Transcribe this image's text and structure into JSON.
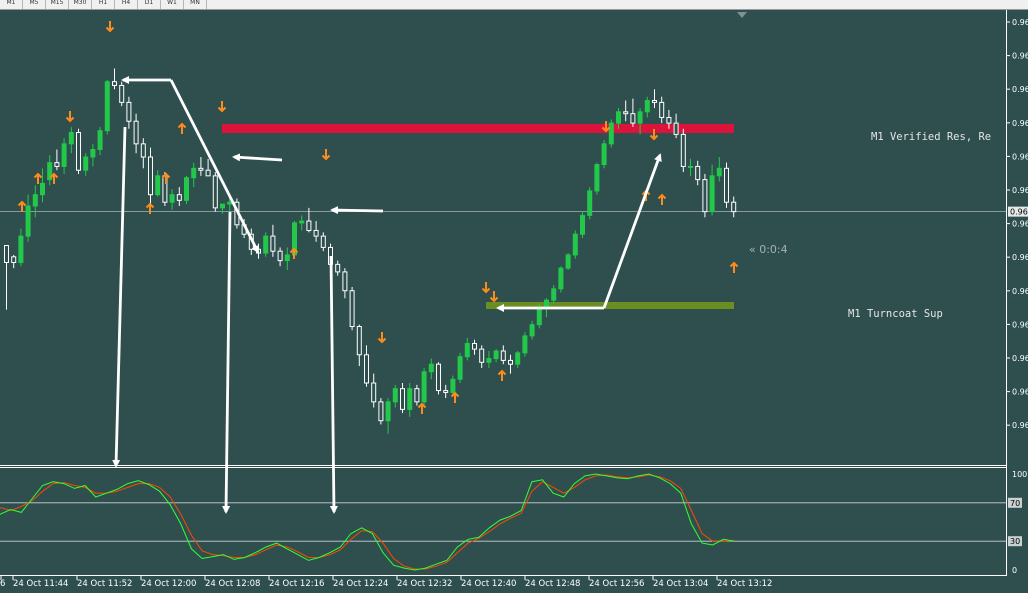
{
  "toolbar": {
    "timeframes": [
      "M1",
      "M5",
      "M15",
      "M30",
      "H1",
      "H4",
      "D1",
      "W1",
      "MN"
    ]
  },
  "chart_data": {
    "type": "candlestick",
    "price_axis_labels": [
      "0.96",
      "0.96",
      "0.96",
      "0.96",
      "0.96",
      "0.96",
      "0.96",
      "0.96",
      "0.96",
      "0.96",
      "0.96",
      "0.96",
      "0.96"
    ],
    "current_price_label": "0.96",
    "countdown": "« 0:0:4",
    "resistance_label": "M1 Verified Res, Re",
    "support_label": "M1 Turncoat Sup",
    "time_labels": [
      "6",
      "24 Oct 11:44",
      "24 Oct 11:52",
      "24 Oct 12:00",
      "24 Oct 12:08",
      "24 Oct 12:16",
      "24 Oct 12:24",
      "24 Oct 12:32",
      "24 Oct 12:40",
      "24 Oct 12:48",
      "24 Oct 12:56",
      "24 Oct 13:04",
      "24 Oct 13:12"
    ],
    "oscillator_levels": [
      100,
      70,
      30,
      0
    ],
    "oscillator_level_labels": [
      "100",
      "70",
      "30",
      "0"
    ],
    "candles": [
      [
        97.2,
        95.6,
        90.4,
        95.4
      ],
      [
        96.0,
        96.2,
        94.8,
        95.4
      ],
      [
        95.4,
        99.0,
        95.0,
        98.2
      ],
      [
        98.2,
        102.6,
        97.6,
        101.4
      ],
      [
        101.4,
        103.6,
        100.2,
        102.6
      ],
      [
        102.6,
        105.4,
        101.8,
        103.8
      ],
      [
        104.2,
        106.8,
        103.6,
        106.0
      ],
      [
        106.0,
        107.4,
        105.2,
        105.6
      ],
      [
        105.6,
        108.6,
        104.8,
        108.0
      ],
      [
        108.0,
        109.8,
        107.0,
        109.2
      ],
      [
        109.2,
        109.6,
        104.8,
        105.2
      ],
      [
        105.2,
        107.0,
        104.6,
        106.6
      ],
      [
        106.6,
        108.0,
        105.6,
        107.4
      ],
      [
        107.4,
        109.8,
        106.8,
        109.4
      ],
      [
        109.4,
        114.8,
        109.0,
        114.6
      ],
      [
        114.6,
        116.0,
        113.8,
        114.2
      ],
      [
        114.2,
        114.6,
        112.0,
        112.4
      ],
      [
        112.4,
        113.0,
        109.6,
        110.4
      ],
      [
        110.4,
        111.2,
        107.0,
        108.0
      ],
      [
        108.0,
        108.6,
        105.4,
        106.6
      ],
      [
        106.6,
        107.6,
        101.6,
        102.6
      ],
      [
        102.6,
        105.2,
        102.4,
        104.6
      ],
      [
        104.6,
        105.0,
        101.4,
        101.8
      ],
      [
        101.8,
        103.2,
        101.0,
        102.6
      ],
      [
        102.6,
        103.4,
        101.4,
        102.0
      ],
      [
        102.0,
        104.6,
        101.6,
        104.4
      ],
      [
        104.4,
        106.0,
        103.4,
        105.4
      ],
      [
        105.4,
        106.6,
        104.6,
        105.2
      ],
      [
        105.2,
        106.4,
        104.6,
        104.6
      ],
      [
        104.6,
        105.0,
        100.8,
        101.2
      ],
      [
        101.2,
        101.6,
        100.6,
        101.6
      ],
      [
        101.6,
        102.4,
        100.8,
        101.8
      ],
      [
        101.8,
        102.2,
        99.0,
        99.4
      ],
      [
        99.4,
        100.0,
        98.0,
        98.4
      ],
      [
        98.4,
        99.0,
        96.2,
        96.8
      ],
      [
        96.8,
        97.4,
        95.8,
        96.4
      ],
      [
        96.4,
        98.6,
        96.0,
        98.2
      ],
      [
        98.2,
        99.4,
        96.0,
        96.6
      ],
      [
        96.6,
        97.0,
        95.0,
        95.6
      ],
      [
        95.6,
        97.0,
        94.6,
        96.2
      ],
      [
        96.2,
        99.8,
        96.0,
        99.6
      ],
      [
        99.6,
        100.4,
        98.8,
        99.8
      ],
      [
        99.8,
        101.2,
        98.6,
        98.8
      ],
      [
        98.8,
        99.8,
        97.6,
        98.2
      ],
      [
        98.2,
        98.6,
        96.6,
        97.0
      ],
      [
        97.0,
        97.4,
        94.6,
        95.2
      ],
      [
        95.2,
        95.6,
        94.0,
        94.4
      ],
      [
        94.4,
        94.8,
        91.6,
        92.4
      ],
      [
        92.4,
        92.8,
        88.2,
        88.6
      ],
      [
        88.6,
        88.8,
        84.4,
        85.6
      ],
      [
        85.6,
        86.6,
        82.2,
        82.6
      ],
      [
        82.6,
        83.6,
        80.0,
        80.6
      ],
      [
        80.6,
        81.0,
        78.2,
        78.6
      ],
      [
        78.6,
        81.0,
        77.2,
        80.6
      ],
      [
        80.6,
        82.4,
        80.0,
        82.0
      ],
      [
        82.0,
        82.6,
        79.4,
        79.8
      ],
      [
        79.8,
        82.6,
        79.0,
        82.0
      ],
      [
        82.0,
        82.4,
        80.2,
        80.6
      ],
      [
        80.6,
        84.2,
        80.2,
        83.8
      ],
      [
        83.8,
        85.2,
        83.0,
        84.6
      ],
      [
        84.6,
        84.8,
        81.4,
        81.8
      ],
      [
        81.8,
        82.4,
        81.0,
        81.6
      ],
      [
        81.6,
        83.4,
        81.2,
        83.0
      ],
      [
        83.0,
        85.8,
        82.6,
        85.4
      ],
      [
        85.4,
        87.4,
        85.0,
        86.8
      ],
      [
        86.8,
        87.2,
        85.6,
        86.2
      ],
      [
        86.2,
        86.6,
        84.2,
        84.8
      ],
      [
        84.8,
        86.0,
        84.2,
        85.2
      ],
      [
        85.2,
        86.2,
        84.8,
        86.0
      ],
      [
        86.0,
        86.6,
        84.6,
        85.0
      ],
      [
        85.0,
        85.6,
        83.6,
        84.6
      ],
      [
        84.6,
        86.0,
        84.2,
        85.8
      ],
      [
        85.8,
        88.0,
        85.4,
        87.6
      ],
      [
        87.6,
        89.2,
        87.2,
        88.8
      ],
      [
        88.8,
        91.0,
        88.4,
        90.6
      ],
      [
        90.6,
        91.6,
        89.6,
        91.4
      ],
      [
        91.4,
        93.0,
        91.0,
        92.6
      ],
      [
        92.6,
        95.0,
        92.2,
        94.8
      ],
      [
        94.8,
        96.4,
        94.6,
        96.2
      ],
      [
        96.2,
        98.8,
        95.8,
        98.4
      ],
      [
        98.4,
        100.8,
        98.0,
        100.4
      ],
      [
        100.4,
        103.4,
        100.0,
        103.0
      ],
      [
        103.0,
        106.0,
        102.6,
        105.8
      ],
      [
        105.8,
        108.4,
        105.4,
        108.0
      ],
      [
        108.0,
        110.6,
        107.6,
        110.2
      ],
      [
        110.2,
        111.8,
        109.6,
        111.4
      ],
      [
        111.4,
        112.6,
        110.4,
        111.2
      ],
      [
        111.2,
        112.8,
        109.8,
        110.2
      ],
      [
        110.2,
        111.8,
        109.0,
        111.4
      ],
      [
        111.4,
        113.0,
        110.8,
        112.6
      ],
      [
        112.6,
        113.8,
        111.8,
        112.4
      ],
      [
        112.4,
        113.0,
        110.2,
        110.8
      ],
      [
        110.8,
        111.6,
        109.6,
        110.2
      ],
      [
        110.2,
        111.2,
        108.6,
        109.0
      ],
      [
        109.0,
        109.6,
        105.0,
        105.6
      ],
      [
        105.6,
        106.4,
        104.6,
        105.6
      ],
      [
        105.6,
        106.2,
        103.6,
        104.2
      ],
      [
        104.2,
        104.8,
        100.2,
        100.8
      ],
      [
        100.8,
        105.8,
        100.4,
        104.6
      ],
      [
        104.6,
        106.6,
        104.0,
        105.4
      ],
      [
        105.4,
        106.0,
        101.2,
        101.8
      ],
      [
        101.8,
        102.4,
        100.2,
        100.8
      ]
    ],
    "oscillator_green": [
      58,
      63,
      60,
      74,
      88,
      92,
      90,
      85,
      88,
      76,
      80,
      84,
      90,
      93,
      89,
      82,
      68,
      48,
      22,
      12,
      14,
      16,
      11,
      13,
      18,
      24,
      28,
      22,
      16,
      10,
      13,
      18,
      24,
      38,
      44,
      38,
      18,
      5,
      2,
      0,
      2,
      6,
      10,
      24,
      32,
      34,
      44,
      52,
      56,
      62,
      92,
      94,
      80,
      76,
      90,
      98,
      100,
      98,
      96,
      95,
      98,
      100,
      96,
      90,
      80,
      48,
      28,
      26,
      32,
      30
    ],
    "oscillator_red": [
      65,
      62,
      66,
      72,
      82,
      90,
      91,
      88,
      86,
      80,
      80,
      82,
      86,
      90,
      90,
      86,
      76,
      58,
      36,
      20,
      16,
      15,
      13,
      13,
      16,
      21,
      26,
      24,
      19,
      13,
      13,
      16,
      21,
      32,
      41,
      40,
      28,
      12,
      4,
      1,
      1,
      4,
      8,
      18,
      28,
      33,
      40,
      48,
      54,
      59,
      82,
      92,
      86,
      80,
      86,
      94,
      98,
      99,
      97,
      96,
      97,
      99,
      97,
      93,
      85,
      62,
      38,
      30,
      30,
      31
    ]
  }
}
